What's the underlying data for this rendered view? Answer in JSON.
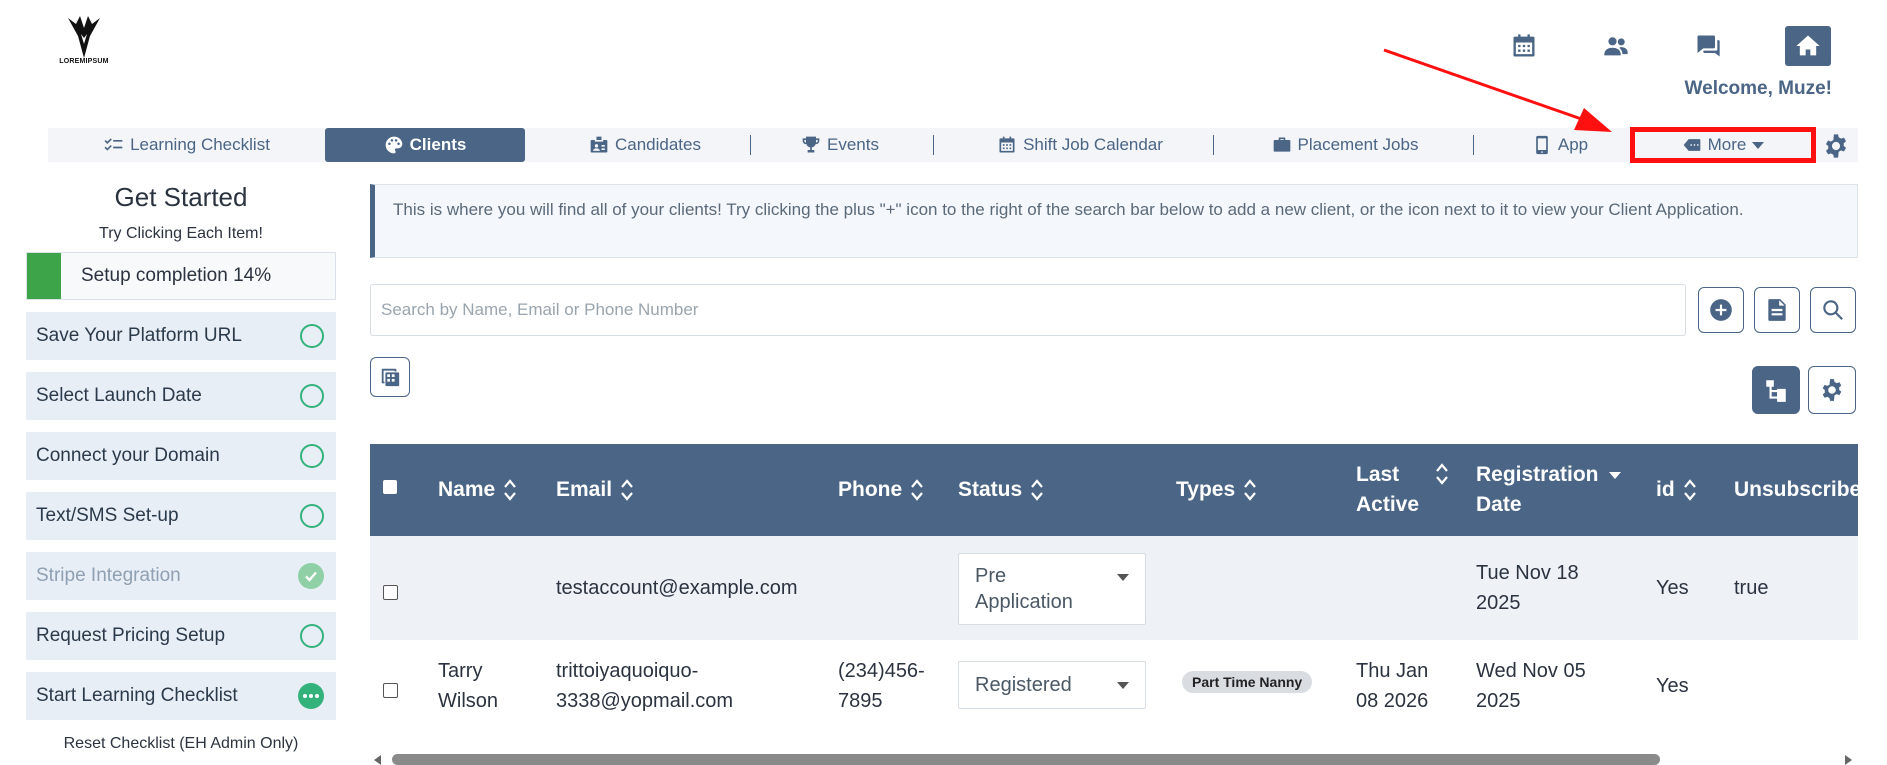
{
  "brand": {
    "logo_text": "LOREMIPSUM"
  },
  "header": {
    "welcome": "Welcome, Muze!",
    "icons": [
      "calendar-icon",
      "users-icon",
      "chat-icon",
      "home-icon"
    ]
  },
  "nav": {
    "tabs": [
      {
        "label": "Learning Checklist",
        "icon": "checklist-icon",
        "active": false
      },
      {
        "label": "Clients",
        "icon": "palette-icon",
        "active": true
      },
      {
        "label": "Candidates",
        "icon": "id-badge-icon",
        "active": false
      },
      {
        "label": "Events",
        "icon": "trophy-icon",
        "active": false
      },
      {
        "label": "Shift Job Calendar",
        "icon": "calendar-icon",
        "active": false
      },
      {
        "label": "Placement Jobs",
        "icon": "briefcase-icon",
        "active": false
      },
      {
        "label": "App",
        "icon": "mobile-icon",
        "active": false
      },
      {
        "label": "More",
        "icon": "tag-icon",
        "active": false
      }
    ],
    "settings_icon": "gear-icon"
  },
  "sidebar": {
    "title": "Get Started",
    "subtitle": "Try Clicking Each Item!",
    "progress_label": "Setup completion 14%",
    "progress_fraction": 0.11,
    "tasks": [
      {
        "label": "Save Your Platform URL",
        "state": "todo"
      },
      {
        "label": "Select Launch Date",
        "state": "todo"
      },
      {
        "label": "Connect your Domain",
        "state": "todo"
      },
      {
        "label": "Text/SMS Set-up",
        "state": "todo"
      },
      {
        "label": "Stripe Integration",
        "state": "done"
      },
      {
        "label": "Request Pricing Setup",
        "state": "todo"
      },
      {
        "label": "Start Learning Checklist",
        "state": "in-progress"
      }
    ],
    "reset_label": "Reset Checklist (EH Admin Only)"
  },
  "main": {
    "info_text": "This is where you will find all of your clients! Try clicking the plus \"+\" icon to the right of the search bar below to add a new client, or the icon next to it to view your Client Application.",
    "search_placeholder": "Search by Name, Email or Phone Number",
    "table": {
      "headers": {
        "name": "Name",
        "email": "Email",
        "phone": "Phone",
        "status": "Status",
        "types": "Types",
        "last_active_1": "Last",
        "last_active_2": "Active",
        "reg_1": "Registration",
        "reg_2": "Date",
        "id": "id",
        "unsubscribed": "Unsubscribed"
      },
      "rows": [
        {
          "name_1": "",
          "name_2": "",
          "email_1": "testaccount@example.com",
          "email_2": "",
          "phone_1": "",
          "phone_2": "",
          "status_1": "Pre",
          "status_2": "Application",
          "type": "",
          "last_1": "",
          "last_2": "",
          "reg_1": "Tue Nov 18",
          "reg_2": "2025",
          "id": "Yes",
          "unsubscribed": "true"
        },
        {
          "name_1": "Tarry",
          "name_2": "Wilson",
          "email_1": "trittoiyaquoiquo-",
          "email_2": "3338@yopmail.com",
          "phone_1": "(234)456-",
          "phone_2": "7895",
          "status_1": "Registered",
          "status_2": "",
          "type": "Part Time Nanny",
          "last_1": "Thu Jan",
          "last_2": "08 2026",
          "reg_1": "Wed Nov 05",
          "reg_2": "2025",
          "id": "Yes",
          "unsubscribed": ""
        }
      ]
    }
  },
  "colors": {
    "primary": "#4a6585",
    "success": "#3ea44a",
    "ring": "#34b27c",
    "annotation": "#ff1010"
  }
}
